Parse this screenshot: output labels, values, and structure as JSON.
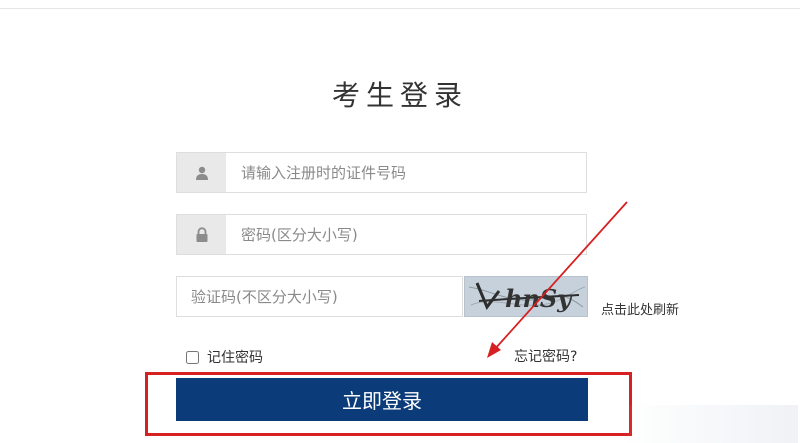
{
  "login": {
    "title": "考生登录",
    "id_placeholder": "请输入注册时的证件号码",
    "password_placeholder": "密码(区分大小写)",
    "captcha_placeholder": "验证码(不区分大小写)",
    "captcha_text": "hnSy",
    "refresh_label": "点击此处刷新",
    "remember_label": "记住密码",
    "forgot_label": "忘记密码?",
    "submit_label": "立即登录"
  },
  "icons": {
    "id_icon": "user-icon",
    "password_icon": "lock-icon"
  },
  "colors": {
    "button_bg": "#0b3c79",
    "annotation_red": "#d62021",
    "icon_bg": "#e9e9e9"
  }
}
